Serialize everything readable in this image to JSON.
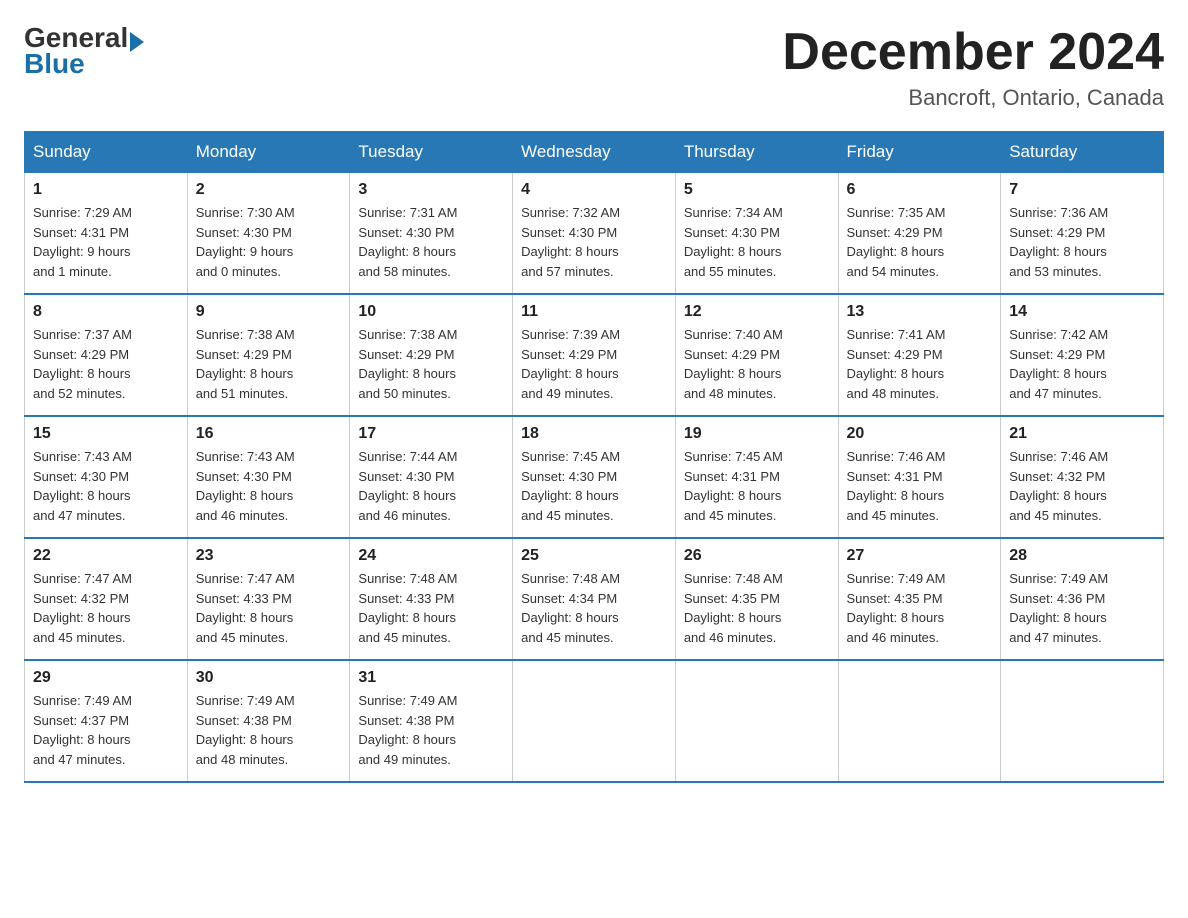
{
  "header": {
    "logo_general": "General",
    "logo_blue": "Blue",
    "month_title": "December 2024",
    "location": "Bancroft, Ontario, Canada"
  },
  "days_of_week": [
    "Sunday",
    "Monday",
    "Tuesday",
    "Wednesday",
    "Thursday",
    "Friday",
    "Saturday"
  ],
  "weeks": [
    [
      {
        "num": "1",
        "sunrise": "7:29 AM",
        "sunset": "4:31 PM",
        "daylight": "9 hours and 1 minute."
      },
      {
        "num": "2",
        "sunrise": "7:30 AM",
        "sunset": "4:30 PM",
        "daylight": "9 hours and 0 minutes."
      },
      {
        "num": "3",
        "sunrise": "7:31 AM",
        "sunset": "4:30 PM",
        "daylight": "8 hours and 58 minutes."
      },
      {
        "num": "4",
        "sunrise": "7:32 AM",
        "sunset": "4:30 PM",
        "daylight": "8 hours and 57 minutes."
      },
      {
        "num": "5",
        "sunrise": "7:34 AM",
        "sunset": "4:30 PM",
        "daylight": "8 hours and 55 minutes."
      },
      {
        "num": "6",
        "sunrise": "7:35 AM",
        "sunset": "4:29 PM",
        "daylight": "8 hours and 54 minutes."
      },
      {
        "num": "7",
        "sunrise": "7:36 AM",
        "sunset": "4:29 PM",
        "daylight": "8 hours and 53 minutes."
      }
    ],
    [
      {
        "num": "8",
        "sunrise": "7:37 AM",
        "sunset": "4:29 PM",
        "daylight": "8 hours and 52 minutes."
      },
      {
        "num": "9",
        "sunrise": "7:38 AM",
        "sunset": "4:29 PM",
        "daylight": "8 hours and 51 minutes."
      },
      {
        "num": "10",
        "sunrise": "7:38 AM",
        "sunset": "4:29 PM",
        "daylight": "8 hours and 50 minutes."
      },
      {
        "num": "11",
        "sunrise": "7:39 AM",
        "sunset": "4:29 PM",
        "daylight": "8 hours and 49 minutes."
      },
      {
        "num": "12",
        "sunrise": "7:40 AM",
        "sunset": "4:29 PM",
        "daylight": "8 hours and 48 minutes."
      },
      {
        "num": "13",
        "sunrise": "7:41 AM",
        "sunset": "4:29 PM",
        "daylight": "8 hours and 48 minutes."
      },
      {
        "num": "14",
        "sunrise": "7:42 AM",
        "sunset": "4:29 PM",
        "daylight": "8 hours and 47 minutes."
      }
    ],
    [
      {
        "num": "15",
        "sunrise": "7:43 AM",
        "sunset": "4:30 PM",
        "daylight": "8 hours and 47 minutes."
      },
      {
        "num": "16",
        "sunrise": "7:43 AM",
        "sunset": "4:30 PM",
        "daylight": "8 hours and 46 minutes."
      },
      {
        "num": "17",
        "sunrise": "7:44 AM",
        "sunset": "4:30 PM",
        "daylight": "8 hours and 46 minutes."
      },
      {
        "num": "18",
        "sunrise": "7:45 AM",
        "sunset": "4:30 PM",
        "daylight": "8 hours and 45 minutes."
      },
      {
        "num": "19",
        "sunrise": "7:45 AM",
        "sunset": "4:31 PM",
        "daylight": "8 hours and 45 minutes."
      },
      {
        "num": "20",
        "sunrise": "7:46 AM",
        "sunset": "4:31 PM",
        "daylight": "8 hours and 45 minutes."
      },
      {
        "num": "21",
        "sunrise": "7:46 AM",
        "sunset": "4:32 PM",
        "daylight": "8 hours and 45 minutes."
      }
    ],
    [
      {
        "num": "22",
        "sunrise": "7:47 AM",
        "sunset": "4:32 PM",
        "daylight": "8 hours and 45 minutes."
      },
      {
        "num": "23",
        "sunrise": "7:47 AM",
        "sunset": "4:33 PM",
        "daylight": "8 hours and 45 minutes."
      },
      {
        "num": "24",
        "sunrise": "7:48 AM",
        "sunset": "4:33 PM",
        "daylight": "8 hours and 45 minutes."
      },
      {
        "num": "25",
        "sunrise": "7:48 AM",
        "sunset": "4:34 PM",
        "daylight": "8 hours and 45 minutes."
      },
      {
        "num": "26",
        "sunrise": "7:48 AM",
        "sunset": "4:35 PM",
        "daylight": "8 hours and 46 minutes."
      },
      {
        "num": "27",
        "sunrise": "7:49 AM",
        "sunset": "4:35 PM",
        "daylight": "8 hours and 46 minutes."
      },
      {
        "num": "28",
        "sunrise": "7:49 AM",
        "sunset": "4:36 PM",
        "daylight": "8 hours and 47 minutes."
      }
    ],
    [
      {
        "num": "29",
        "sunrise": "7:49 AM",
        "sunset": "4:37 PM",
        "daylight": "8 hours and 47 minutes."
      },
      {
        "num": "30",
        "sunrise": "7:49 AM",
        "sunset": "4:38 PM",
        "daylight": "8 hours and 48 minutes."
      },
      {
        "num": "31",
        "sunrise": "7:49 AM",
        "sunset": "4:38 PM",
        "daylight": "8 hours and 49 minutes."
      },
      null,
      null,
      null,
      null
    ]
  ],
  "labels": {
    "sunrise_prefix": "Sunrise: ",
    "sunset_prefix": "Sunset: ",
    "daylight_prefix": "Daylight: "
  }
}
